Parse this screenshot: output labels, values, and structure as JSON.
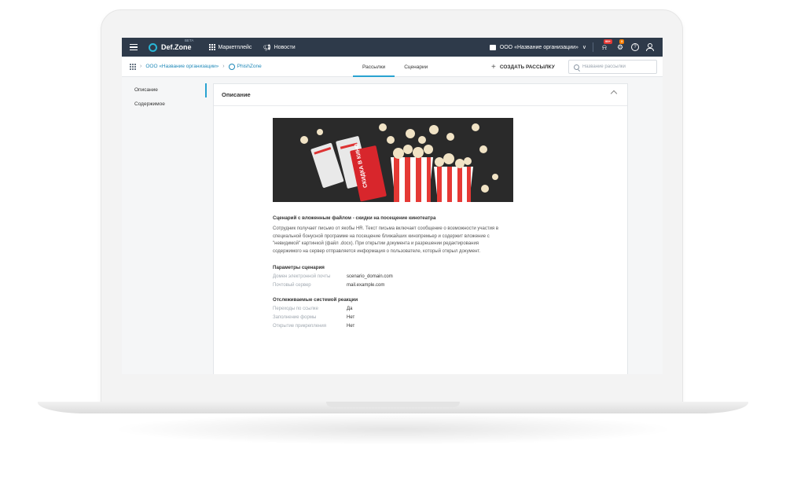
{
  "topbar": {
    "brand": "Def.Zone",
    "beta": "BETA",
    "marketplace": "Маркетплейс",
    "news": "Новости",
    "org": "ООО «Название организации»",
    "notifications_count": "99+",
    "settings_count": "3"
  },
  "subbar": {
    "breadcrumb_org": "ООО «Название организации»",
    "breadcrumb_app": "PhishZone",
    "tabs": [
      {
        "label": "Рассылки",
        "active": true
      },
      {
        "label": "Сценарии",
        "active": false
      }
    ],
    "create_label": "СОЗДАТЬ РАССЫЛКУ",
    "search_placeholder": "Название рассылки"
  },
  "leftnav": {
    "items": [
      {
        "label": "Описание",
        "active": true
      },
      {
        "label": "Содержимое",
        "active": false
      }
    ]
  },
  "card": {
    "title": "Описание",
    "scenario_title": "Сценарий с вложенным файлом - скидки на посещение кинотеатра",
    "scenario_desc": "Сотрудник получает письмо от якобы HR. Текст письма включает сообщение о возможности участия в специальной бонусной программе на посещение ближайших кинопремьер и содержит вложение с \"невидимой\" картинкой (файл .docx). При открытии документа и разрешении редактирования содержимого на сервер отправляется информация о пользователе, который открыл документ.",
    "params_title": "Параметры сценария",
    "params": [
      {
        "key": "Домен электронной почты",
        "value": "scenario_domain.com"
      },
      {
        "key": "Почтовый сервер",
        "value": "mail.example.com"
      }
    ],
    "reactions_title": "Отслеживаемые системой реакции",
    "reactions": [
      {
        "key": "Переходы по ссылке",
        "value": "Да"
      },
      {
        "key": "Заполнение формы",
        "value": "Нет"
      },
      {
        "key": "Открытие прикрепления",
        "value": "Нет"
      }
    ],
    "ticket_text": "СКИДКА В КИНО"
  },
  "colors": {
    "topbar_bg": "#2e3a4a",
    "accent": "#29a3d1",
    "link": "#1e88b8"
  }
}
